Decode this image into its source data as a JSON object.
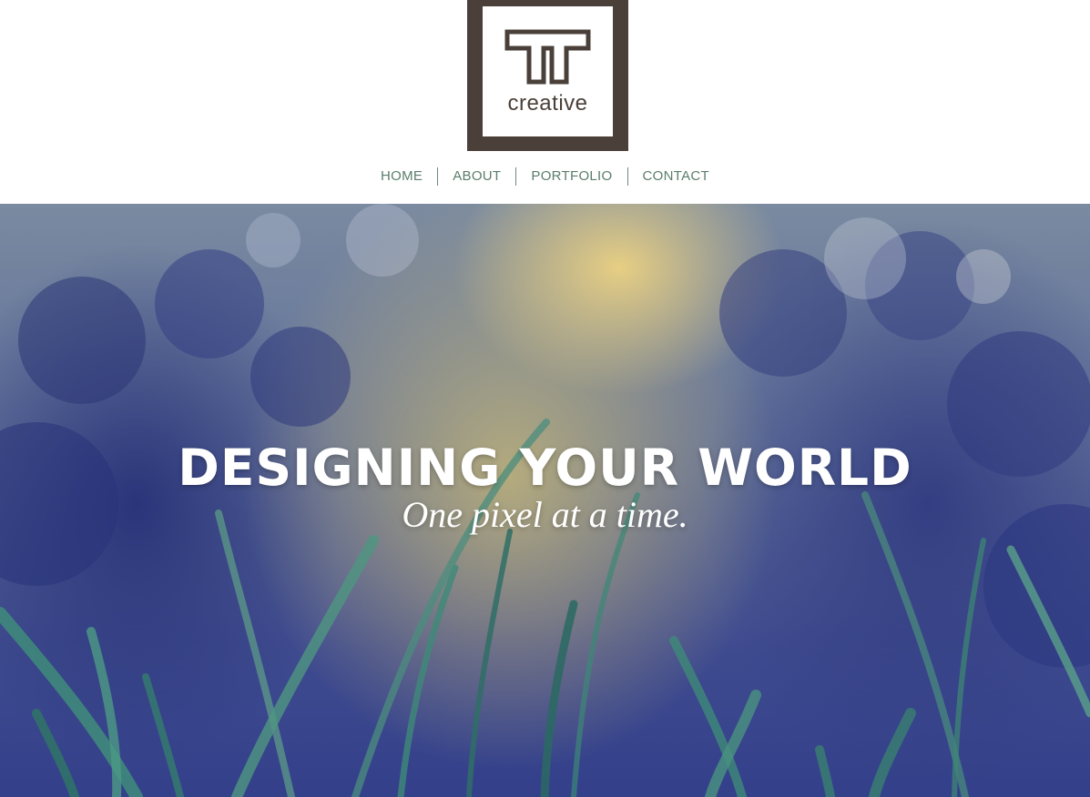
{
  "brand": {
    "logo_text": "creative",
    "logo_border_color": "#4a4039"
  },
  "nav": {
    "items": [
      {
        "label": "HOME"
      },
      {
        "label": "ABOUT"
      },
      {
        "label": "PORTFOLIO"
      },
      {
        "label": "CONTACT"
      }
    ],
    "link_color": "#5b7d6c"
  },
  "hero": {
    "title": "DESIGNING YOUR WORLD",
    "subtitle": "One pixel at a time.",
    "image_icon": "grass-sky-photo"
  }
}
